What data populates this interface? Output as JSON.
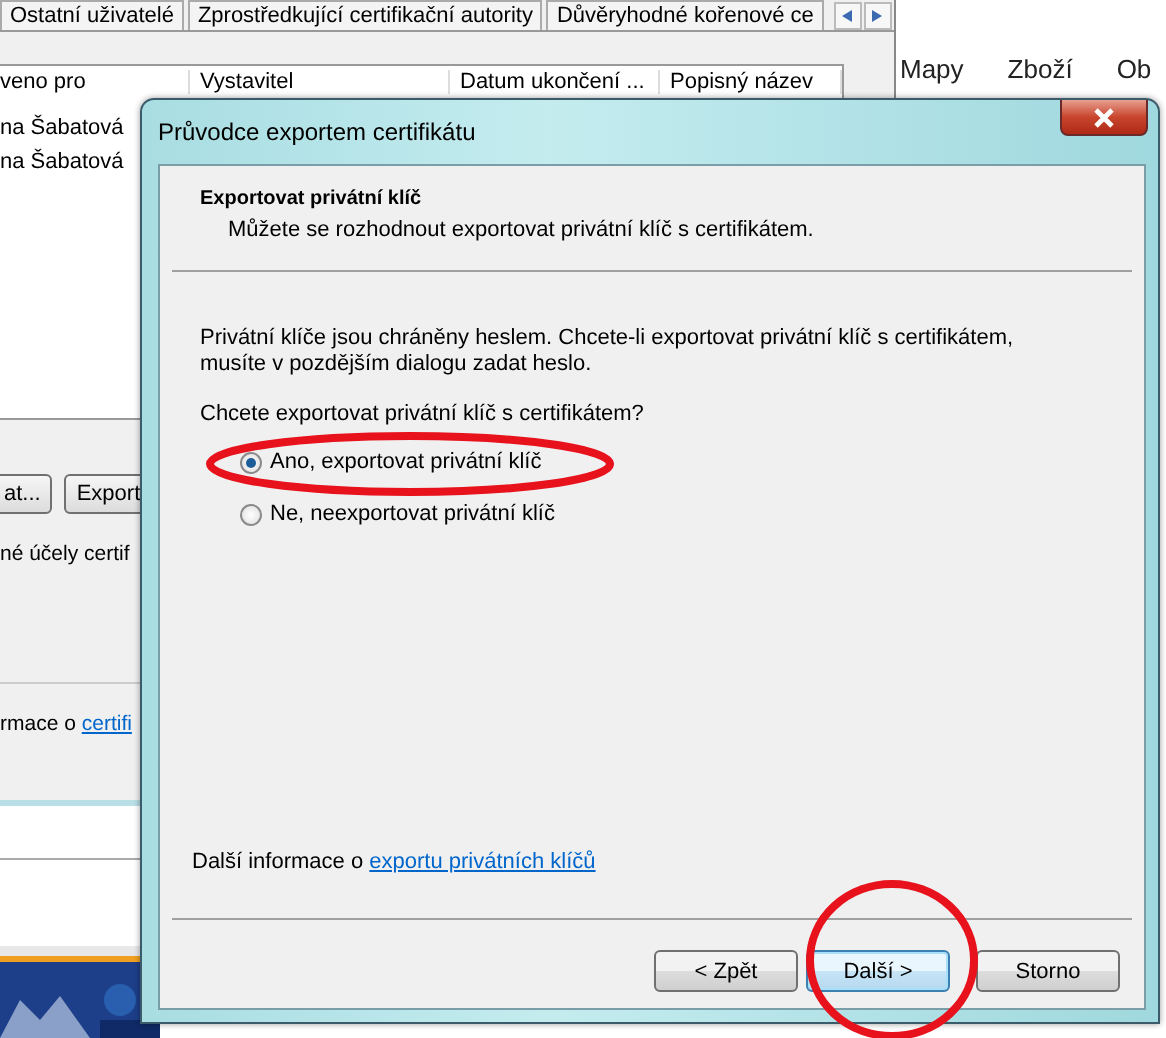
{
  "background_page": {
    "nav_items": [
      "Mapy",
      "Zboží",
      "Ob"
    ]
  },
  "cert_manager": {
    "tabs": [
      "Ostatní uživatelé",
      "Zprostředkující certifikační autority",
      "Důvěryhodné kořenové ce"
    ],
    "columns": [
      "veno pro",
      "Vystavitel",
      "Datum ukončení ...",
      "Popisný název"
    ],
    "rows": [
      [
        "na Šabatová"
      ],
      [
        "na Šabatová"
      ]
    ],
    "buttons": [
      "at...",
      "Export"
    ],
    "purposes_text": "né účely certif",
    "info_text": "rmace o ",
    "info_link": "certifi"
  },
  "dialog": {
    "title": "Průvodce exportem certifikátu",
    "header_title": "Exportovat privátní klíč",
    "header_subtitle": "Můžete se rozhodnout exportovat privátní klíč s certifikátem.",
    "description": "Privátní klíče jsou chráněny heslem. Chcete-li exportovat privátní klíč s certifikátem, musíte v pozdějším dialogu zadat heslo.",
    "question": "Chcete exportovat privátní klíč s certifikátem?",
    "options": [
      {
        "label": "Ano, exportovat privátní klíč",
        "selected": true
      },
      {
        "label": "Ne, neexportovat privátní klíč",
        "selected": false
      }
    ],
    "info_text": "Další informace o ",
    "info_link": "exportu privátních klíčů",
    "buttons": [
      {
        "label": "< Zpět",
        "focused": false
      },
      {
        "label": "Další >",
        "focused": true
      },
      {
        "label": "Storno",
        "focused": false
      }
    ]
  }
}
